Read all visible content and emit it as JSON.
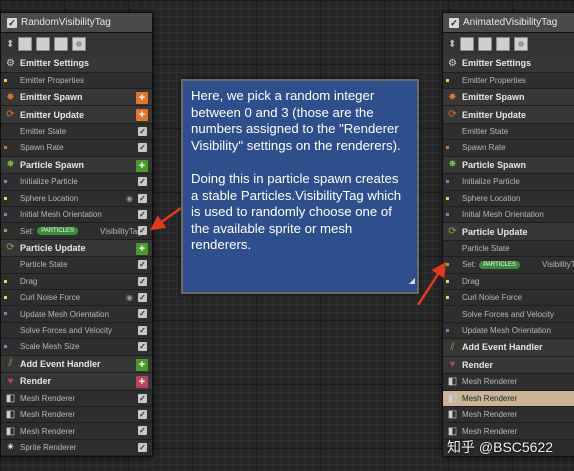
{
  "left_emitter": {
    "title": "RandomVisibilityTag",
    "rows": [
      {
        "type": "section",
        "label": "Emitter Settings",
        "icon": "gear-icon",
        "icon_glyph": "⚙",
        "icon_class": "ico-grey"
      },
      {
        "type": "sub",
        "label": "Emitter Properties",
        "mark": "y"
      },
      {
        "type": "section",
        "label": "Emitter Spawn",
        "icon": "spawn-icon",
        "icon_glyph": "✸",
        "icon_class": "ico-orange",
        "add": "orange"
      },
      {
        "type": "section",
        "label": "Emitter Update",
        "icon": "update-icon",
        "icon_glyph": "⟳",
        "icon_class": "ico-orange",
        "add": "orange"
      },
      {
        "type": "sub",
        "label": "Emitter State",
        "check": true
      },
      {
        "type": "sub",
        "label": "Spawn Rate",
        "mark": "o",
        "check": true
      },
      {
        "type": "section",
        "label": "Particle Spawn",
        "icon": "particle-spawn-icon",
        "icon_glyph": "✸",
        "icon_class": "ico-green",
        "add": "green"
      },
      {
        "type": "sub",
        "label": "Initialize Particle",
        "mark": "b",
        "check": true
      },
      {
        "type": "sub",
        "label": "Sphere Location",
        "mark": "y",
        "check": true,
        "extra": "◉"
      },
      {
        "type": "sub",
        "label": "Initial Mesh Orientation",
        "mark": "b",
        "check": true
      },
      {
        "type": "sub",
        "label": "Set:",
        "pill": "PARTICLES",
        "suffix": "VisibilityTag",
        "mark": "g",
        "check": true
      },
      {
        "type": "section",
        "label": "Particle Update",
        "icon": "particle-update-icon",
        "icon_glyph": "⟳",
        "icon_class": "ico-green",
        "add": "green"
      },
      {
        "type": "sub",
        "label": "Particle State",
        "check": true
      },
      {
        "type": "sub",
        "label": "Drag",
        "mark": "y",
        "check": true
      },
      {
        "type": "sub",
        "label": "Curl Noise Force",
        "mark": "y",
        "check": true,
        "extra": "◉"
      },
      {
        "type": "sub",
        "label": "Update Mesh Orientation",
        "mark": "b",
        "check": true
      },
      {
        "type": "sub",
        "label": "Solve Forces and Velocity",
        "check": true
      },
      {
        "type": "sub",
        "label": "Scale Mesh Size",
        "mark": "b",
        "check": true
      },
      {
        "type": "section",
        "label": "Add Event Handler",
        "icon": "event-handler-icon",
        "icon_glyph": "⫽",
        "icon_class": "ico-green",
        "add": "green"
      },
      {
        "type": "section",
        "label": "Render",
        "icon": "render-icon",
        "icon_glyph": "♥",
        "icon_class": "ico-red",
        "add": "red"
      },
      {
        "type": "sub",
        "label": "Mesh Renderer",
        "icon_glyph": "◧",
        "check": true
      },
      {
        "type": "sub",
        "label": "Mesh Renderer",
        "icon_glyph": "◧",
        "check": true
      },
      {
        "type": "sub",
        "label": "Mesh Renderer",
        "icon_glyph": "◧",
        "check": true
      },
      {
        "type": "sub",
        "label": "Sprite Renderer",
        "icon_glyph": "✷",
        "check": true
      }
    ]
  },
  "right_emitter": {
    "title": "AnimatedVisibilityTag",
    "rows": [
      {
        "type": "section",
        "label": "Emitter Settings",
        "icon": "gear-icon",
        "icon_glyph": "⚙",
        "icon_class": "ico-grey"
      },
      {
        "type": "sub",
        "label": "Emitter Properties",
        "mark": "y"
      },
      {
        "type": "section",
        "label": "Emitter Spawn",
        "icon": "spawn-icon",
        "icon_glyph": "✸",
        "icon_class": "ico-orange"
      },
      {
        "type": "section",
        "label": "Emitter Update",
        "icon": "update-icon",
        "icon_glyph": "⟳",
        "icon_class": "ico-orange"
      },
      {
        "type": "sub",
        "label": "Emitter State"
      },
      {
        "type": "sub",
        "label": "Spawn Rate",
        "mark": "o"
      },
      {
        "type": "section",
        "label": "Particle Spawn",
        "icon": "particle-spawn-icon",
        "icon_glyph": "✸",
        "icon_class": "ico-green"
      },
      {
        "type": "sub",
        "label": "Initialize Particle",
        "mark": "b"
      },
      {
        "type": "sub",
        "label": "Sphere Location",
        "mark": "y"
      },
      {
        "type": "sub",
        "label": "Initial Mesh Orientation",
        "mark": "b"
      },
      {
        "type": "section",
        "label": "Particle Update",
        "icon": "particle-update-icon",
        "icon_glyph": "⟳",
        "icon_class": "ico-green"
      },
      {
        "type": "sub",
        "label": "Particle State"
      },
      {
        "type": "sub",
        "label": "Set:",
        "pill": "PARTICLES",
        "suffix": "VisibilityTag",
        "mark": "g"
      },
      {
        "type": "sub",
        "label": "Drag",
        "mark": "y"
      },
      {
        "type": "sub",
        "label": "Curl Noise Force",
        "mark": "y"
      },
      {
        "type": "sub",
        "label": "Solve Forces and Velocity"
      },
      {
        "type": "sub",
        "label": "Update Mesh Orientation",
        "mark": "b"
      },
      {
        "type": "section",
        "label": "Add Event Handler",
        "icon": "event-handler-icon",
        "icon_glyph": "⫽",
        "icon_class": "ico-green"
      },
      {
        "type": "section",
        "label": "Render",
        "icon": "render-icon",
        "icon_glyph": "♥",
        "icon_class": "ico-red"
      },
      {
        "type": "sub",
        "label": "Mesh Renderer",
        "icon_glyph": "◧"
      },
      {
        "type": "sub",
        "label": "Mesh Renderer",
        "icon_glyph": "◧",
        "highlight": true
      },
      {
        "type": "sub",
        "label": "Mesh Renderer",
        "icon_glyph": "◧"
      },
      {
        "type": "sub",
        "label": "Mesh Renderer",
        "icon_glyph": "◧"
      }
    ]
  },
  "comment": {
    "paragraph1": "Here, we pick a random integer between 0 and 3 (those are the numbers assigned to the \"Renderer Visibility\" settings on the renderers).",
    "paragraph2": "Doing this in particle spawn creates a stable Particles.VisibilityTag which is used to randomly choose one of the available sprite or mesh renderers."
  },
  "watermark": "知乎 @BSC5622",
  "colors": {
    "comment_bg": "#2f4f8c",
    "arrow": "#e03a1e",
    "accent_orange": "#e0762a",
    "accent_green": "#4c9a2a",
    "accent_red": "#b8445a"
  }
}
